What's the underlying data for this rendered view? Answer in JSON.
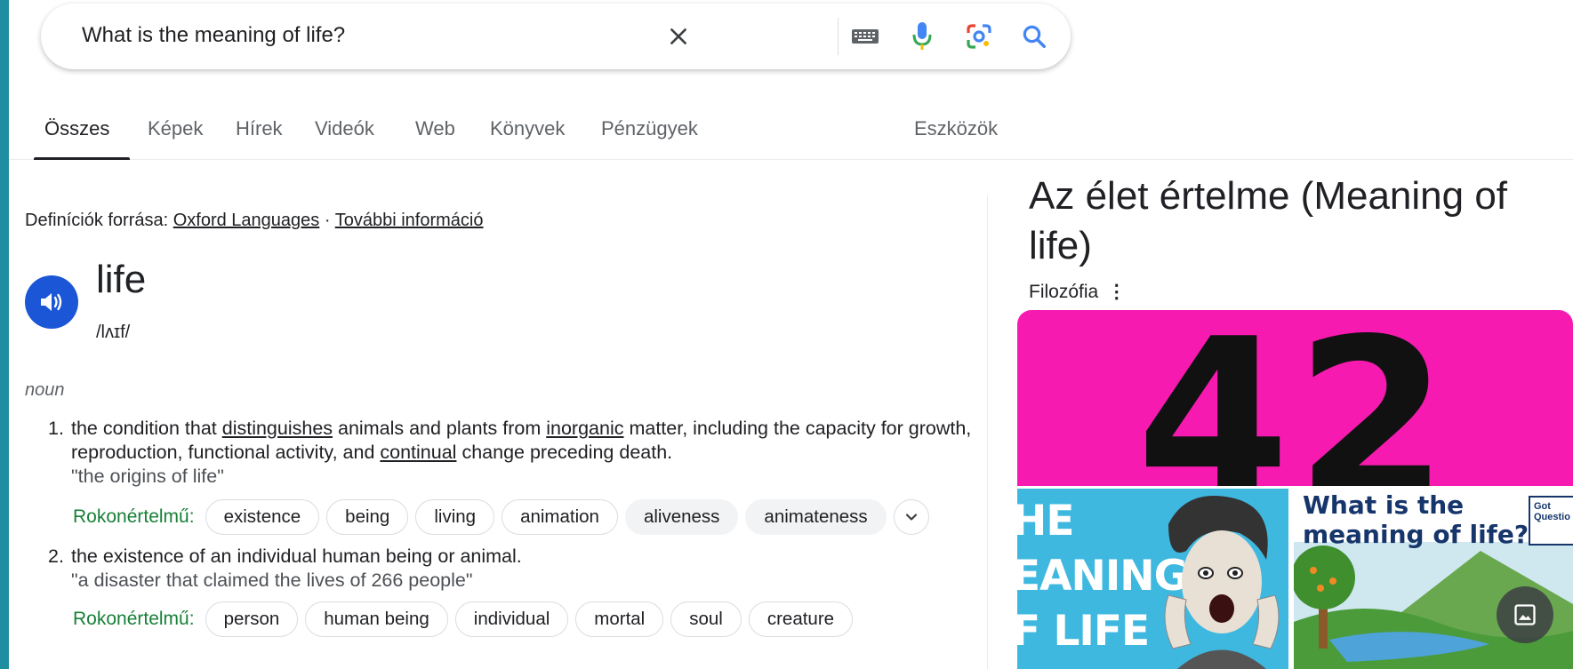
{
  "search": {
    "query": "What is the meaning of life?",
    "icons": [
      "close-icon",
      "keyboard-icon",
      "microphone-icon",
      "lens-icon",
      "search-icon"
    ]
  },
  "tabs": [
    {
      "label": "Összes",
      "active": true
    },
    {
      "label": "Képek"
    },
    {
      "label": "Hírek"
    },
    {
      "label": "Videók"
    },
    {
      "label": "Web"
    },
    {
      "label": "Könyvek"
    },
    {
      "label": "Pénzügyek"
    }
  ],
  "tools_label": "Eszközök",
  "dictionary": {
    "source_prefix": "Definíciók forrása:",
    "source_link": "Oxford Languages",
    "separator": "·",
    "more_info": "További információ",
    "word": "life",
    "phonetic": "/lʌɪf/",
    "part_of_speech": "noun",
    "synonyms_label": "Rokonértelmű:",
    "definitions": [
      {
        "number": "1.",
        "text_parts": [
          "the condition that ",
          "distinguishes",
          " animals and plants from ",
          "inorganic",
          " matter, including the capacity for growth, reproduction, functional activity, and ",
          "continual",
          " change preceding death."
        ],
        "example": "\"the origins of life\"",
        "synonyms": [
          "existence",
          "being",
          "living",
          "animation",
          "aliveness",
          "animateness"
        ]
      },
      {
        "number": "2.",
        "text": "the existence of an individual human being or animal.",
        "example": "\"a disaster that claimed the lives of 266 people\"",
        "synonyms": [
          "person",
          "human being",
          "individual",
          "mortal",
          "soul",
          "creature"
        ]
      }
    ]
  },
  "knowledge_panel": {
    "title": "Az élet értelme (Meaning of life)",
    "subtitle": "Filozófia",
    "more_icon": "⋮",
    "images": {
      "main_text": "42",
      "left_text": [
        "HE",
        "EANING",
        "F LIFE"
      ],
      "right_text": [
        "What is the",
        "meaning of life?"
      ],
      "right_logo": [
        "Got",
        "Questio"
      ]
    },
    "colors": {
      "main_bg": "#f71ab0",
      "left_bg": "#3fb8e0",
      "right_title": "#16356b"
    }
  },
  "colors": {
    "page_border": "#1e8ea0",
    "synonym_label": "#188038",
    "speaker": "#1a56d6"
  }
}
